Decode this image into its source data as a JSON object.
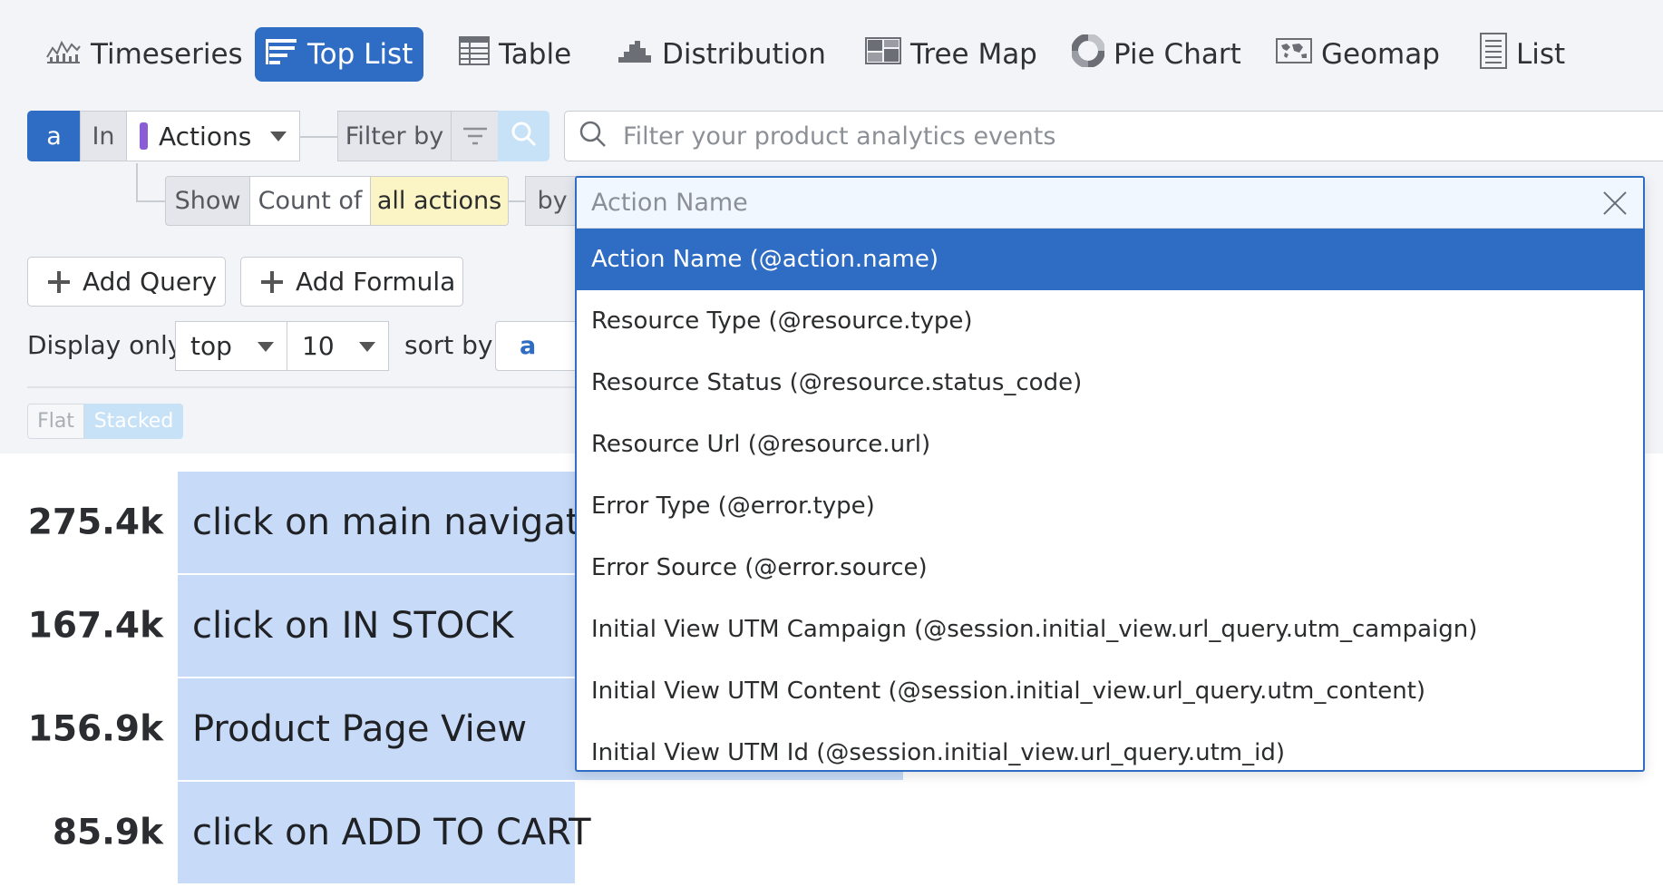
{
  "viz_tabs": [
    {
      "label": "Timeseries",
      "icon": "timeseries-icon"
    },
    {
      "label": "Top List",
      "icon": "toplist-icon",
      "active": true
    },
    {
      "label": "Table",
      "icon": "table-icon"
    },
    {
      "label": "Distribution",
      "icon": "distribution-icon"
    },
    {
      "label": "Tree Map",
      "icon": "treemap-icon"
    },
    {
      "label": "Pie Chart",
      "icon": "piechart-icon"
    },
    {
      "label": "Geomap",
      "icon": "geomap-icon"
    },
    {
      "label": "List",
      "icon": "list-icon"
    }
  ],
  "query": {
    "letter": "a",
    "in_label": "In",
    "source": "Actions",
    "filter_by_label": "Filter by",
    "search_placeholder": "Filter your product analytics events",
    "show_label": "Show",
    "count_of_label": "Count of",
    "measure": "all actions",
    "by_label": "by"
  },
  "buttons": {
    "add_query": "Add Query",
    "add_formula": "Add Formula"
  },
  "display": {
    "display_only_label": "Display only",
    "top_value": "top",
    "limit_value": "10",
    "sort_by_label": "sort by",
    "sort_value": "a"
  },
  "mode_toggle": {
    "flat": "Flat",
    "stacked": "Stacked"
  },
  "toplist": [
    {
      "value": "275.4k",
      "label": "click on main navigatio",
      "fraction": 1.0
    },
    {
      "value": "167.4k",
      "label": "click on IN STOCK",
      "fraction": 0.608
    },
    {
      "value": "156.9k",
      "label": "Product Page View",
      "fraction": 0.57
    },
    {
      "value": "85.9k",
      "label": "click on ADD TO CART",
      "fraction": 0.312
    }
  ],
  "dropdown": {
    "search_placeholder": "Action Name",
    "items": [
      "Action Name (@action.name)",
      "Resource Type (@resource.type)",
      "Resource Status (@resource.status_code)",
      "Resource Url (@resource.url)",
      "Error Type (@error.type)",
      "Error Source (@error.source)",
      "Initial View UTM Campaign (@session.initial_view.url_query.utm_campaign)",
      "Initial View UTM Content (@session.initial_view.url_query.utm_content)",
      "Initial View UTM Id (@session.initial_view.url_query.utm_id)"
    ],
    "selected_index": 0
  },
  "colors": {
    "accent": "#2f6cc3",
    "bar": "#c7dbf8",
    "source_marker": "#8a5cd6",
    "measure_highlight": "#fbf4c4"
  }
}
